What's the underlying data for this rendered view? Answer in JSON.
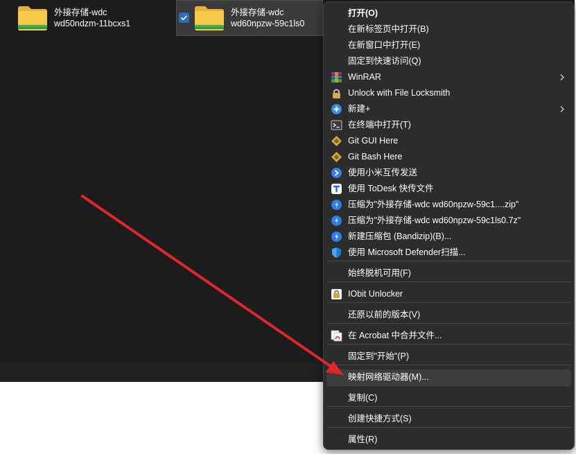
{
  "files": [
    {
      "line1": "外接存储-wdc",
      "line2": "wd50ndzm-11bcxs1",
      "selected": false
    },
    {
      "line1": "外接存储-wdc",
      "line2": "wd60npzw-59c1ls0",
      "selected": true
    }
  ],
  "menu": {
    "items": [
      {
        "label": "打开(O)",
        "icon": "none",
        "bold": true
      },
      {
        "label": "在新标签页中打开(B)",
        "icon": "none"
      },
      {
        "label": "在新窗口中打开(E)",
        "icon": "none"
      },
      {
        "label": "固定到快速访问(Q)",
        "icon": "none"
      },
      {
        "label": "WinRAR",
        "icon": "winrar-icon",
        "submenu": true
      },
      {
        "label": "Unlock with File Locksmith",
        "icon": "lock-icon"
      },
      {
        "label": "新建+",
        "icon": "plus-circle-icon",
        "submenu": true
      },
      {
        "label": "在终端中打开(T)",
        "icon": "terminal-icon"
      },
      {
        "label": "Git GUI Here",
        "icon": "git-icon"
      },
      {
        "label": "Git Bash Here",
        "icon": "git-icon"
      },
      {
        "label": "使用小米互传发送",
        "icon": "xiaomi-share-icon"
      },
      {
        "label": "使用 ToDesk 快传文件",
        "icon": "todesk-icon"
      },
      {
        "label": "压缩为\"外接存储-wdc wd60npzw-59c1....zip\"",
        "icon": "bandizip-icon"
      },
      {
        "label": "压缩为\"外接存储-wdc wd60npzw-59c1ls0.7z\"",
        "icon": "bandizip-icon"
      },
      {
        "label": "新建压缩包 (Bandizip)(B)...",
        "icon": "bandizip-icon"
      },
      {
        "label": "使用 Microsoft Defender扫描...",
        "icon": "defender-shield-icon"
      },
      {
        "label": "始终脱机可用(F)",
        "icon": "none"
      },
      {
        "label": "IObit Unlocker",
        "icon": "iobit-icon"
      },
      {
        "label": "还原以前的版本(V)",
        "icon": "none"
      },
      {
        "label": "在 Acrobat 中合并文件...",
        "icon": "acrobat-icon"
      },
      {
        "label": "固定到\"开始\"(P)",
        "icon": "none"
      },
      {
        "label": "映射网络驱动器(M)...",
        "icon": "none",
        "hover": true
      },
      {
        "label": "复制(C)",
        "icon": "none"
      },
      {
        "label": "创建快捷方式(S)",
        "icon": "none"
      },
      {
        "label": "属性(R)",
        "icon": "none"
      }
    ]
  },
  "colors": {
    "accent_arrow": "#e0262b",
    "folder": "#f3c043",
    "menu_bg": "#2c2c2c",
    "explorer_bg": "#1c1c1c"
  }
}
